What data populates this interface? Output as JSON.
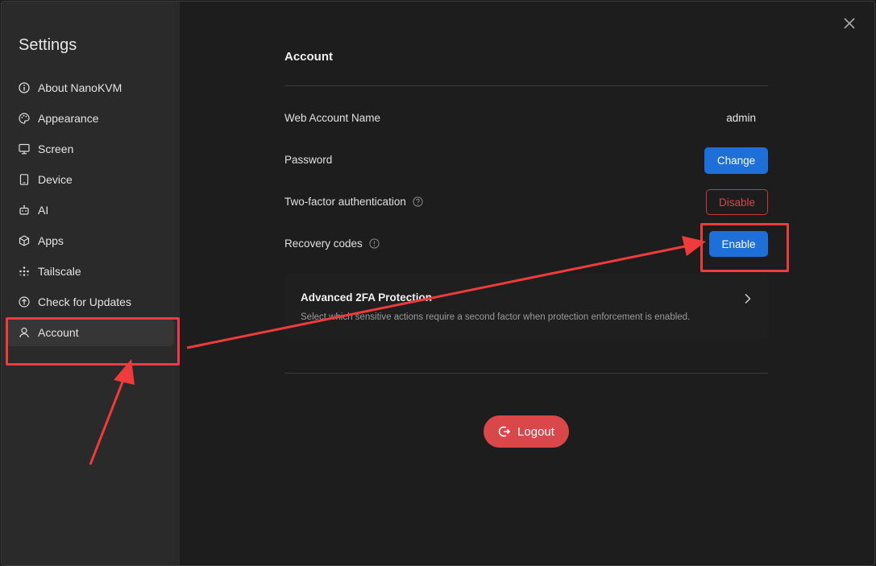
{
  "sidebar": {
    "title": "Settings",
    "items": [
      {
        "label": "About NanoKVM",
        "icon": "info-circle-icon"
      },
      {
        "label": "Appearance",
        "icon": "palette-icon"
      },
      {
        "label": "Screen",
        "icon": "monitor-icon"
      },
      {
        "label": "Device",
        "icon": "device-icon"
      },
      {
        "label": "AI",
        "icon": "robot-icon"
      },
      {
        "label": "Apps",
        "icon": "cube-icon"
      },
      {
        "label": "Tailscale",
        "icon": "tailscale-icon"
      },
      {
        "label": "Check for Updates",
        "icon": "arrow-up-circle-icon"
      },
      {
        "label": "Account",
        "icon": "user-icon",
        "active": true
      }
    ]
  },
  "account": {
    "title": "Account",
    "web_account_name_label": "Web Account Name",
    "web_account_name_value": "admin",
    "password_label": "Password",
    "password_button": "Change",
    "two_factor_label": "Two-factor authentication",
    "two_factor_button": "Disable",
    "recovery_codes_label": "Recovery codes",
    "recovery_codes_button": "Enable",
    "advanced_card": {
      "title": "Advanced 2FA Protection",
      "description": "Select which sensitive actions require a second factor when protection enforcement is enabled."
    },
    "logout_label": "Logout"
  },
  "colors": {
    "primary": "#1f6fd9",
    "danger": "#d9474b",
    "annotation": "#ef3b3b"
  }
}
